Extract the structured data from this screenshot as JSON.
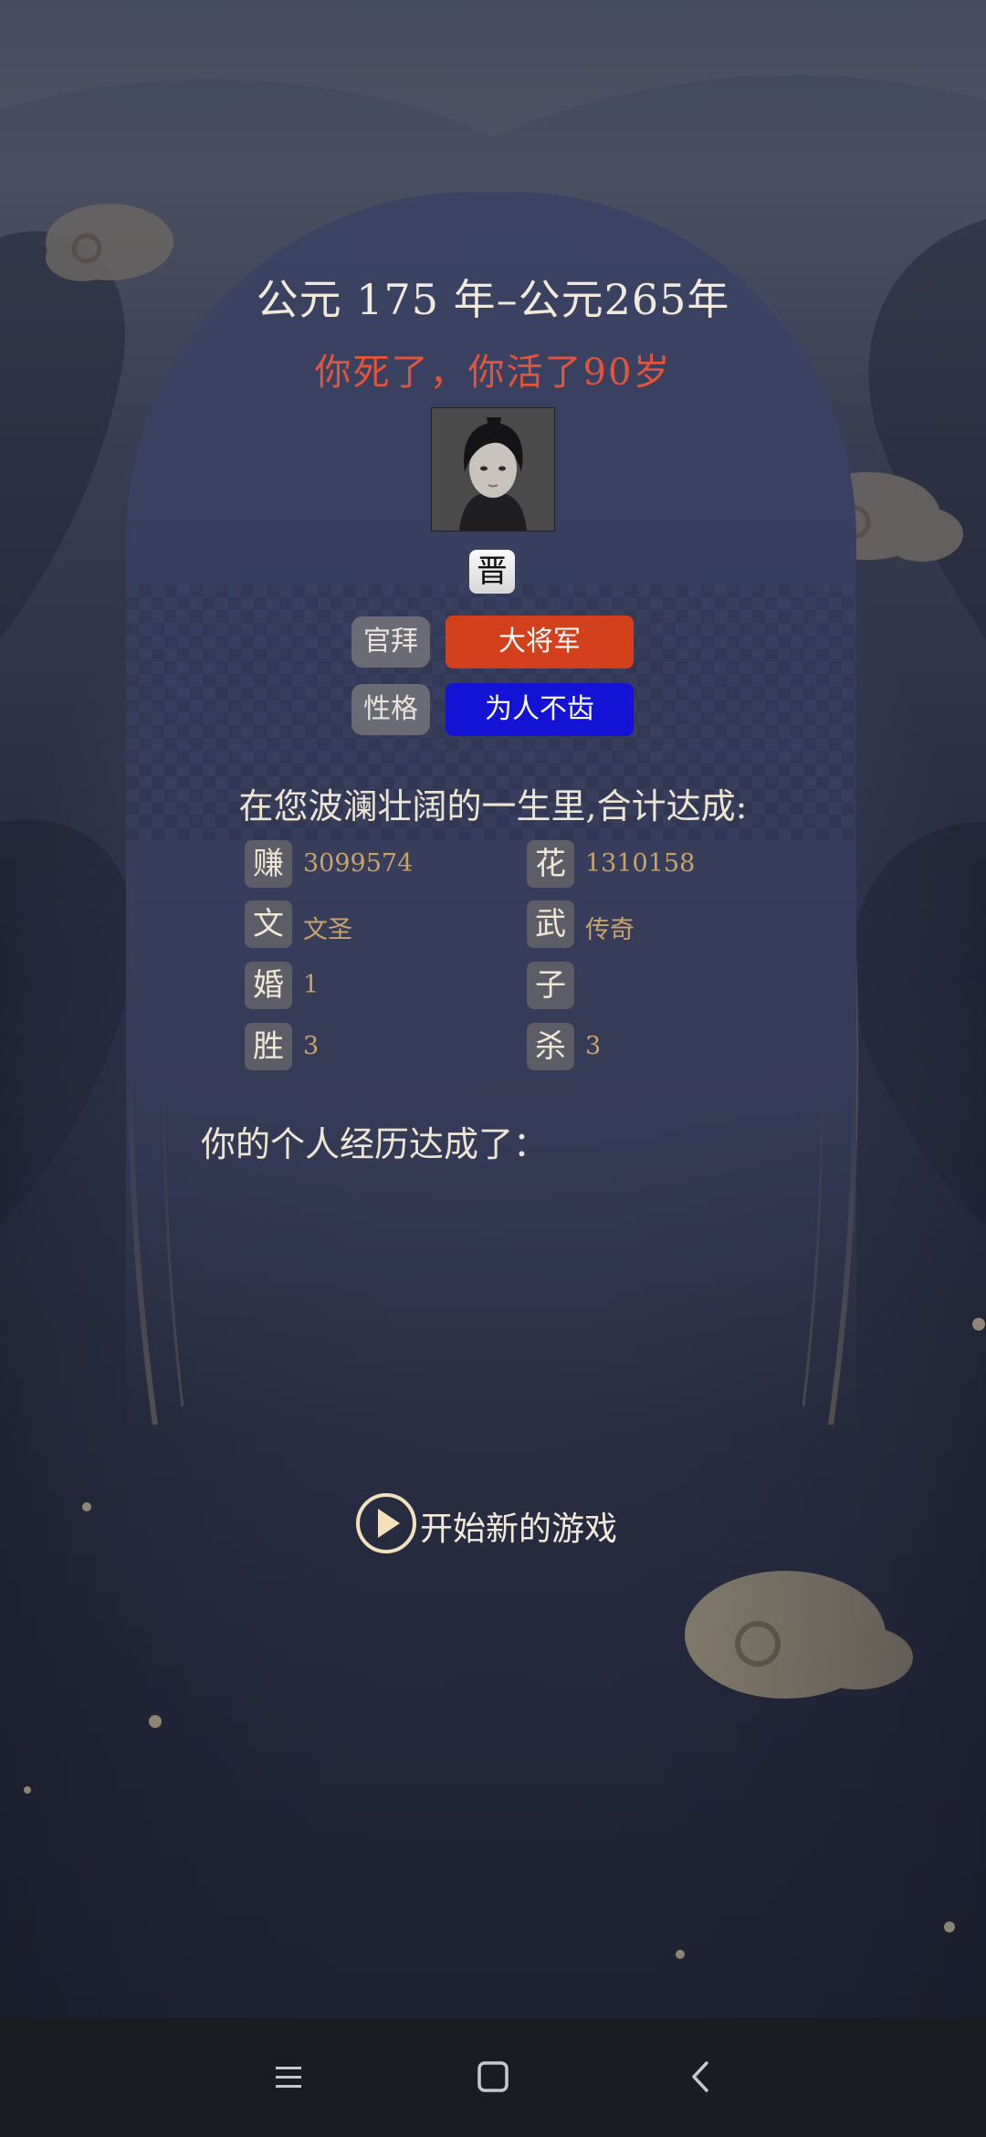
{
  "header": {
    "date_range": "公元 175 年–公元265年",
    "death_message": "你死了，你活了90岁"
  },
  "character": {
    "dynasty": "晋",
    "title_label": "官拜",
    "title_value": "大将军",
    "title_color": "#d2401c",
    "personality_label": "性格",
    "personality_value": "为人不齿",
    "personality_color": "#1313d6"
  },
  "summary": {
    "intro": "在您波澜壮阔的一生里,合计达成:",
    "stats": [
      {
        "key": "赚",
        "value": "3099574"
      },
      {
        "key": "花",
        "value": "1310158"
      },
      {
        "key": "文",
        "value": "文圣"
      },
      {
        "key": "武",
        "value": "传奇"
      },
      {
        "key": "婚",
        "value": "1"
      },
      {
        "key": "子",
        "value": ""
      },
      {
        "key": "胜",
        "value": "3"
      },
      {
        "key": "杀",
        "value": "3"
      }
    ]
  },
  "experience": {
    "label": "你的个人经历达成了："
  },
  "actions": {
    "new_game": "开始新的游戏",
    "new_game_icon": "play-circle-icon"
  },
  "nav": {
    "menu_icon": "menu-icon",
    "home_icon": "home-square-icon",
    "back_icon": "back-chevron-icon"
  }
}
